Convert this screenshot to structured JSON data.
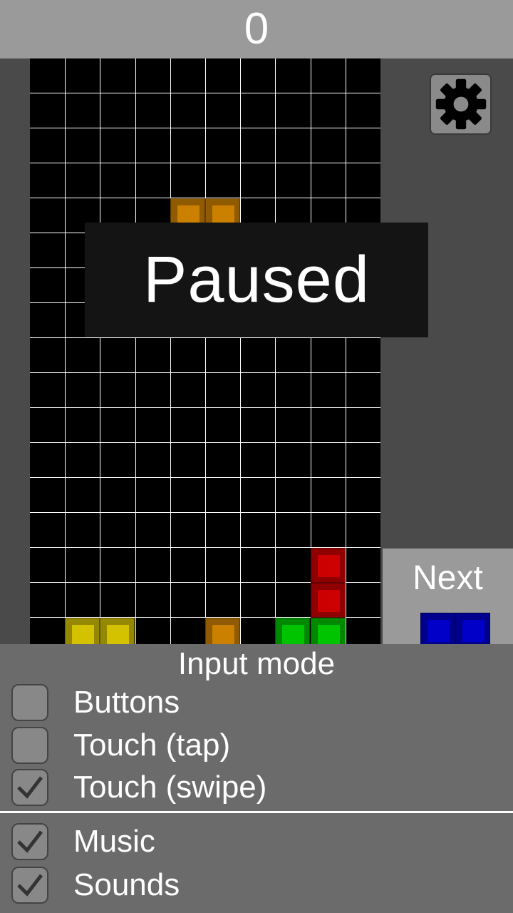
{
  "score": "0",
  "colors": {
    "orange": "#cc8000",
    "yellow": "#d4c200",
    "green": "#00c400",
    "red": "#cc0000",
    "blue": "#0000c8"
  },
  "board": {
    "cols": 10,
    "rows": 17,
    "blocks": [
      {
        "col": 4,
        "row": 4,
        "color": "orange"
      },
      {
        "col": 5,
        "row": 4,
        "color": "orange"
      },
      {
        "col": 8,
        "row": 14,
        "color": "red"
      },
      {
        "col": 8,
        "row": 15,
        "color": "red"
      },
      {
        "col": 1,
        "row": 16,
        "color": "yellow"
      },
      {
        "col": 2,
        "row": 16,
        "color": "yellow"
      },
      {
        "col": 5,
        "row": 16,
        "color": "orange"
      },
      {
        "col": 7,
        "row": 16,
        "color": "green"
      },
      {
        "col": 8,
        "row": 16,
        "color": "green"
      }
    ]
  },
  "settings_icon": "gear-icon",
  "next": {
    "label": "Next",
    "piece_color": "blue"
  },
  "paused_text": "Paused",
  "input_panel": {
    "title": "Input mode",
    "options": [
      {
        "label": "Buttons",
        "checked": false
      },
      {
        "label": "Touch (tap)",
        "checked": false
      },
      {
        "label": "Touch (swipe)",
        "checked": true
      }
    ]
  },
  "audio": [
    {
      "label": "Music",
      "checked": true
    },
    {
      "label": "Sounds",
      "checked": true
    }
  ]
}
